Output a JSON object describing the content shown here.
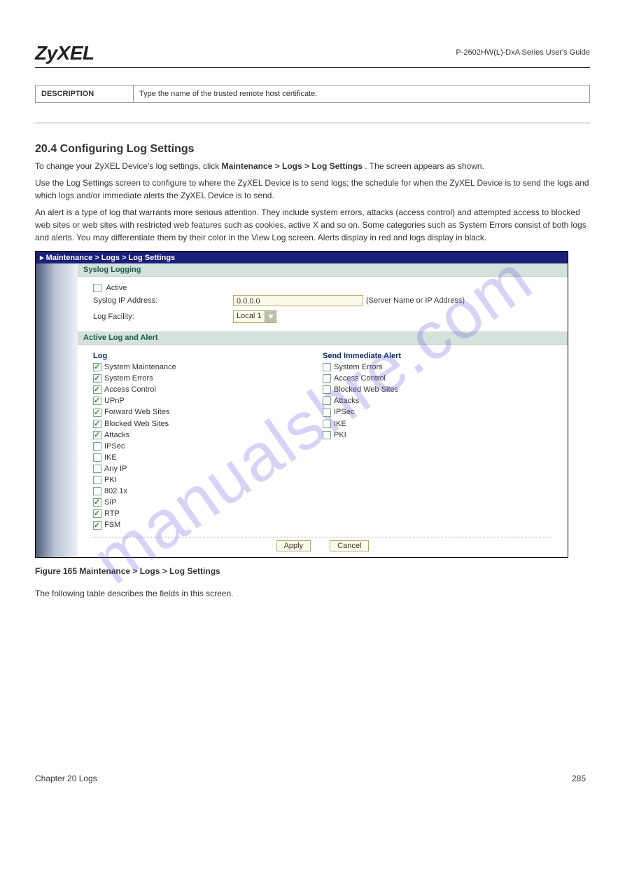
{
  "header": {
    "logo": "ZyXEL",
    "doc_title": "P-2602HW(L)-DxA Series User's Guide"
  },
  "top_table": {
    "label": "DESCRIPTION",
    "value": "Type the name of the trusted remote host certificate."
  },
  "section": {
    "title": "20.4  Configuring Log Settings",
    "para1_prefix": "To change your ZyXEL Device's log settings, click ",
    "para1_path": "Maintenance > Logs > Log Settings",
    "para1_suffix": ". The screen appears as shown.",
    "para2": "Use the Log Settings screen to configure to where the ZyXEL Device is to send logs; the schedule for when the ZyXEL Device is to send the logs and which logs and/or immediate alerts the ZyXEL Device is to send.",
    "para3": "An alert is a type of log that warrants more serious attention. They include system errors, attacks (access control) and attempted access to blocked web sites or web sites with restricted web features such as cookies, active X and so on. Some categories such as System Errors consist of both logs and alerts. You may differentiate them by their color in the View Log screen. Alerts display in red and logs display in black."
  },
  "shot": {
    "breadcrumb": "Maintenance > Logs > Log Settings",
    "syslog": {
      "title": "Syslog Logging",
      "active_label": "Active",
      "active_checked": false,
      "ip_label": "Syslog IP Address:",
      "ip_value": "0.0.0.0",
      "ip_hint": "(Server Name or IP Address)",
      "facility_label": "Log Facility:",
      "facility_value": "Local 1"
    },
    "active_log": {
      "title": "Active Log and Alert",
      "log_heading": "Log",
      "alert_heading": "Send Immediate Alert",
      "log_items": [
        {
          "label": "System Maintenance",
          "checked": true
        },
        {
          "label": "System Errors",
          "checked": true
        },
        {
          "label": "Access Control",
          "checked": true
        },
        {
          "label": "UPnP",
          "checked": true
        },
        {
          "label": "Forward Web Sites",
          "checked": true
        },
        {
          "label": "Blocked Web Sites",
          "checked": true
        },
        {
          "label": "Attacks",
          "checked": true
        },
        {
          "label": "IPSec",
          "checked": false
        },
        {
          "label": "IKE",
          "checked": false
        },
        {
          "label": "Any IP",
          "checked": false
        },
        {
          "label": "PKI",
          "checked": false
        },
        {
          "label": "802.1x",
          "checked": false
        },
        {
          "label": "SIP",
          "checked": true
        },
        {
          "label": "RTP",
          "checked": true
        },
        {
          "label": "FSM",
          "checked": true
        }
      ],
      "alert_items": [
        {
          "label": "System Errors",
          "checked": false
        },
        {
          "label": "Access Control",
          "checked": false
        },
        {
          "label": "Blocked Web Sites",
          "checked": false
        },
        {
          "label": "Attacks",
          "checked": false
        },
        {
          "label": "IPSec",
          "checked": false
        },
        {
          "label": "IKE",
          "checked": false
        },
        {
          "label": "PKI",
          "checked": false
        }
      ]
    },
    "buttons": {
      "apply": "Apply",
      "cancel": "Cancel"
    }
  },
  "figure": {
    "caption": "Figure 165   Maintenance > Logs > Log Settings",
    "following": "The following table describes the fields in this screen."
  },
  "footer": {
    "chapter": "Chapter 20 Logs",
    "page": "285"
  },
  "watermark": "manualshre.com"
}
